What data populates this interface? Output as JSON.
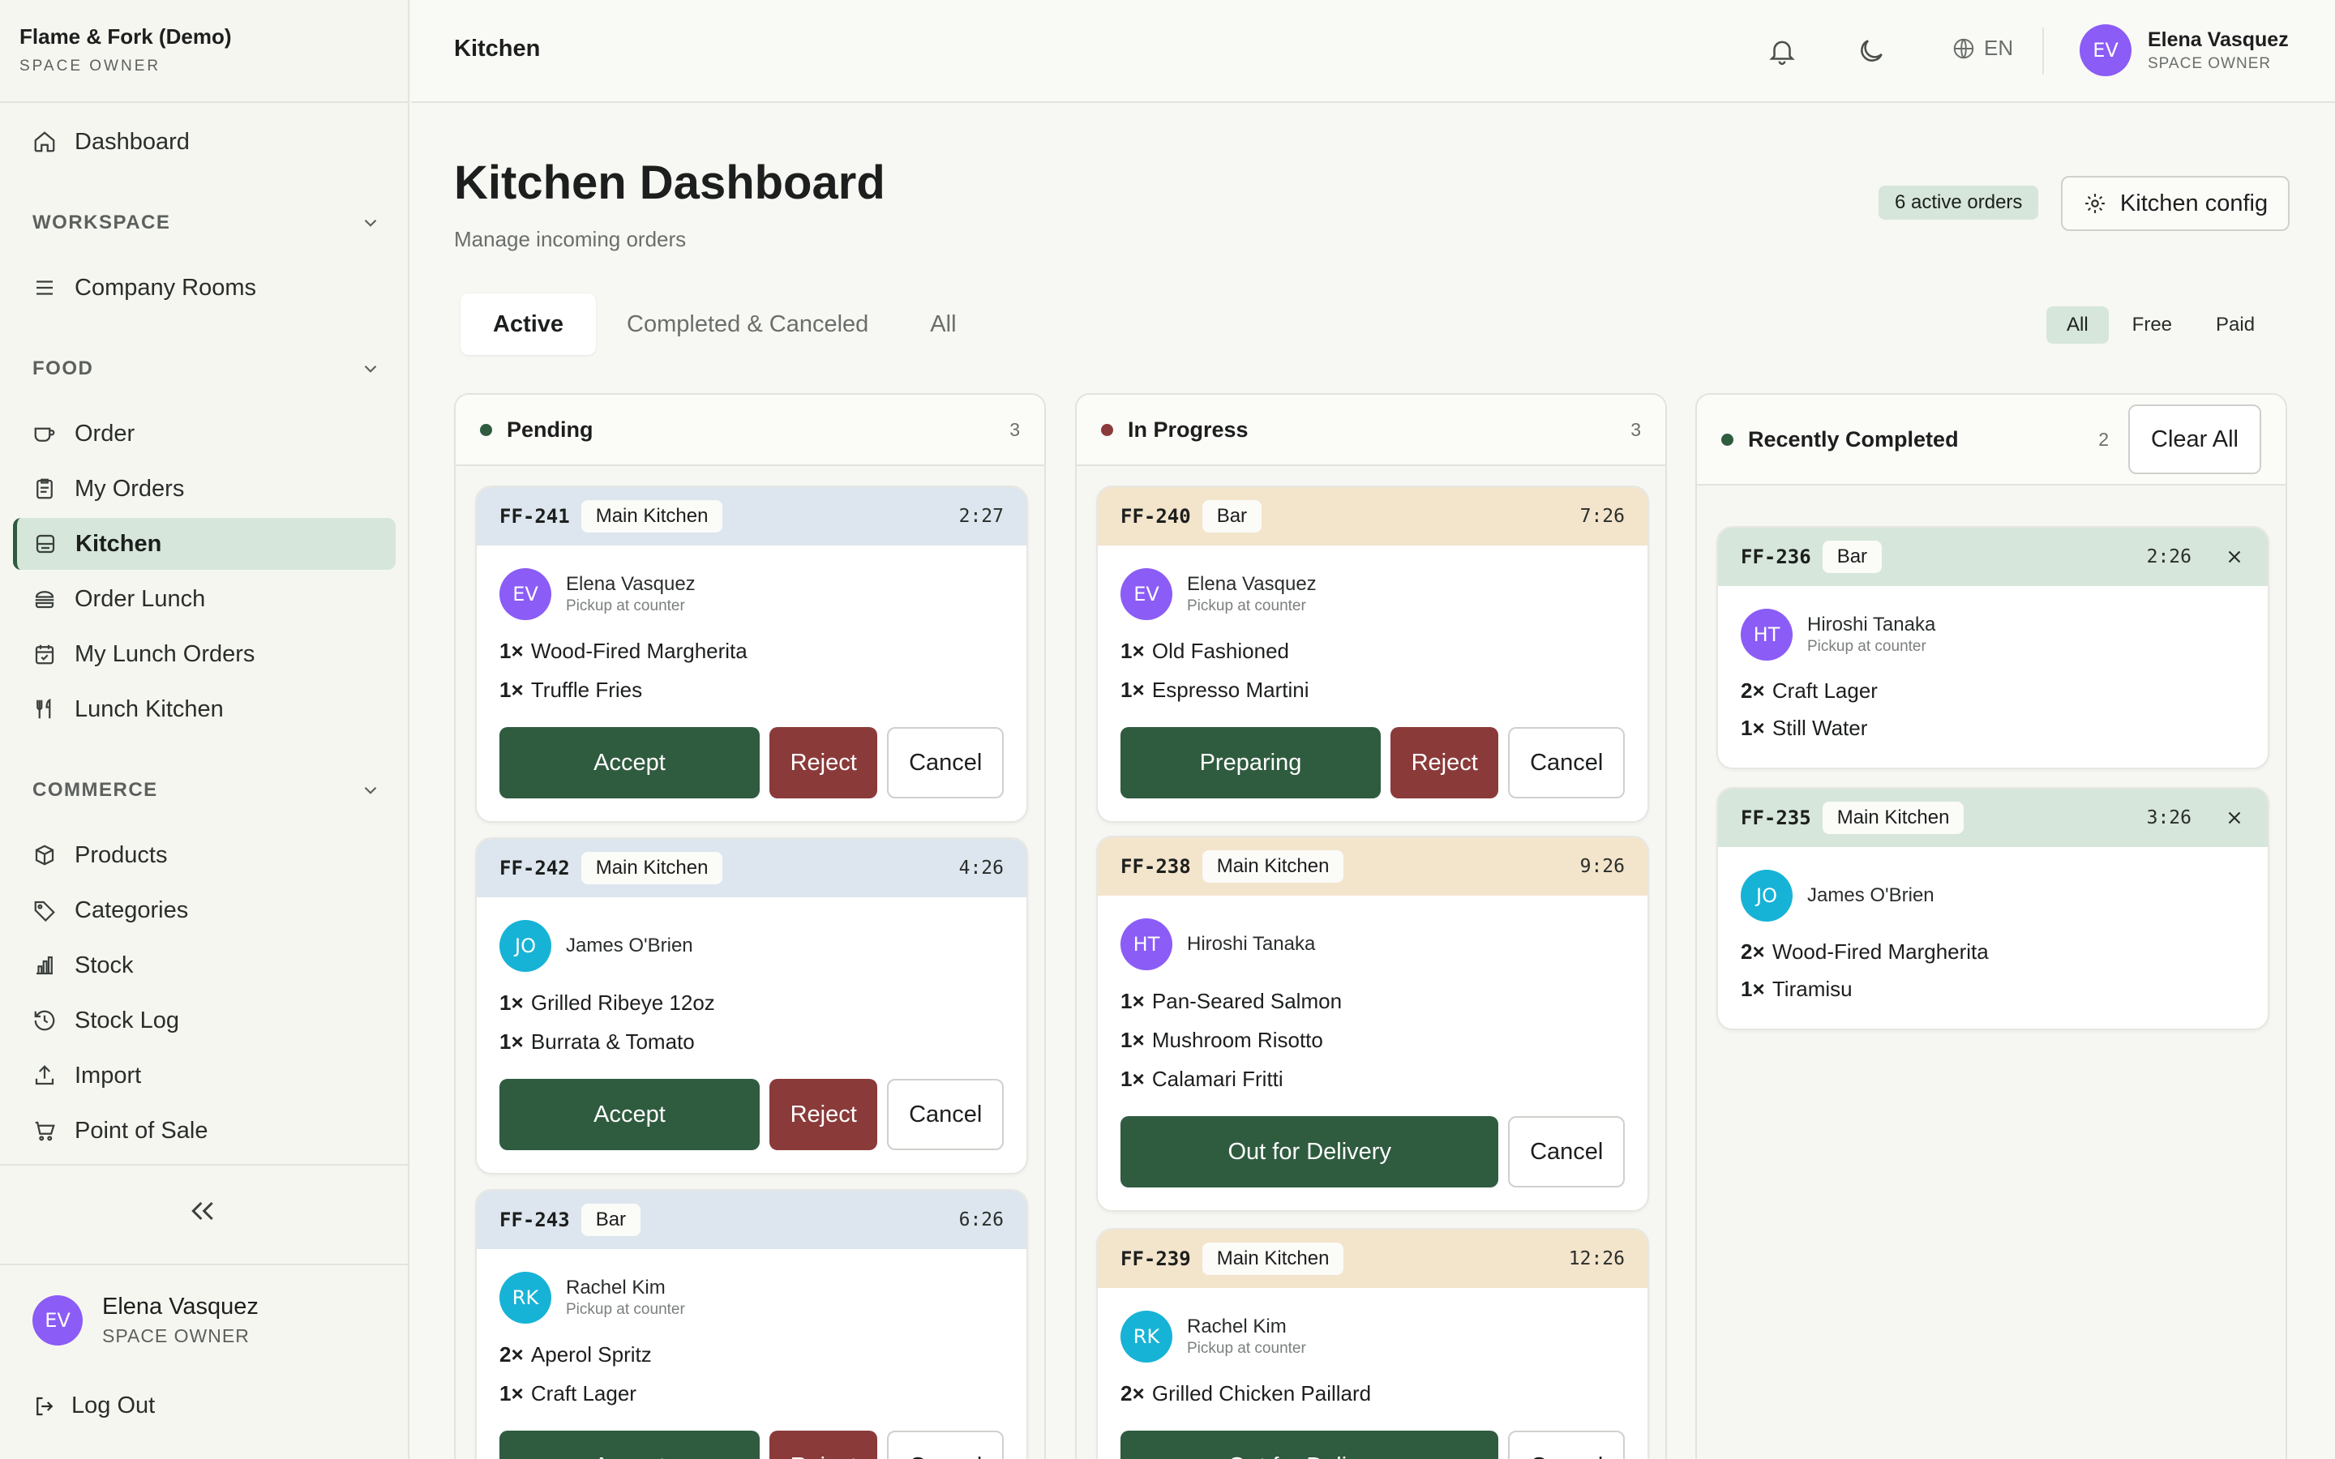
{
  "sidebar": {
    "brand_name": "Flame & Fork (Demo)",
    "brand_role": "SPACE OWNER",
    "dashboard": "Dashboard",
    "sections": {
      "workspace": "WORKSPACE",
      "food": "FOOD",
      "commerce": "COMMERCE"
    },
    "items": {
      "company_rooms": "Company Rooms",
      "order": "Order",
      "my_orders": "My Orders",
      "kitchen": "Kitchen",
      "order_lunch": "Order Lunch",
      "my_lunch_orders": "My Lunch Orders",
      "lunch_kitchen": "Lunch Kitchen",
      "products": "Products",
      "categories": "Categories",
      "stock": "Stock",
      "stock_log": "Stock Log",
      "import": "Import",
      "point_of_sale": "Point of Sale"
    },
    "user": {
      "initials": "EV",
      "name": "Elena Vasquez",
      "role": "SPACE OWNER"
    },
    "logout": "Log Out"
  },
  "topbar": {
    "title": "Kitchen",
    "lang": "EN",
    "user": {
      "initials": "EV",
      "name": "Elena Vasquez",
      "role": "SPACE OWNER"
    }
  },
  "page": {
    "title": "Kitchen Dashboard",
    "subtitle": "Manage incoming orders",
    "active_badge": "6 active orders",
    "config_button": "Kitchen config"
  },
  "tabs": [
    "Active",
    "Completed & Canceled",
    "All"
  ],
  "filters": [
    "All",
    "Free",
    "Paid"
  ],
  "columns": {
    "pending": {
      "title": "Pending",
      "count": "3",
      "dot_color": "#2f5b3f",
      "cards": [
        {
          "id": "FF-241",
          "station": "Main Kitchen",
          "time": "2:27",
          "initials": "EV",
          "customer": "Elena Vasquez",
          "note": "Pickup at counter",
          "items": [
            {
              "qty": "1×",
              "name": "Wood-Fired Margherita"
            },
            {
              "qty": "1×",
              "name": "Truffle Fries"
            }
          ],
          "primary": "Accept",
          "reject": "Reject",
          "cancel": "Cancel"
        },
        {
          "id": "FF-242",
          "station": "Main Kitchen",
          "time": "4:26",
          "initials": "JO",
          "customer": "James O'Brien",
          "note": "",
          "items": [
            {
              "qty": "1×",
              "name": "Grilled Ribeye 12oz"
            },
            {
              "qty": "1×",
              "name": "Burrata & Tomato"
            }
          ],
          "primary": "Accept",
          "reject": "Reject",
          "cancel": "Cancel"
        },
        {
          "id": "FF-243",
          "station": "Bar",
          "time": "6:26",
          "initials": "RK",
          "customer": "Rachel Kim",
          "note": "Pickup at counter",
          "items": [
            {
              "qty": "2×",
              "name": "Aperol Spritz"
            },
            {
              "qty": "1×",
              "name": "Craft Lager"
            }
          ],
          "primary": "Accept",
          "reject": "Reject",
          "cancel": "Cancel"
        }
      ]
    },
    "in_progress": {
      "title": "In Progress",
      "count": "3",
      "dot_color": "#8b3a3a",
      "cards": [
        {
          "id": "FF-240",
          "station": "Bar",
          "time": "7:26",
          "initials": "EV",
          "customer": "Elena Vasquez",
          "note": "Pickup at counter",
          "items": [
            {
              "qty": "1×",
              "name": "Old Fashioned"
            },
            {
              "qty": "1×",
              "name": "Espresso Martini"
            }
          ],
          "primary": "Preparing",
          "reject": "Reject",
          "cancel": "Cancel"
        },
        {
          "id": "FF-238",
          "station": "Main Kitchen",
          "time": "9:26",
          "initials": "HT",
          "customer": "Hiroshi Tanaka",
          "note": "",
          "items": [
            {
              "qty": "1×",
              "name": "Pan-Seared Salmon"
            },
            {
              "qty": "1×",
              "name": "Mushroom Risotto"
            },
            {
              "qty": "1×",
              "name": "Calamari Fritti"
            }
          ],
          "primary": "Out for Delivery",
          "cancel": "Cancel"
        },
        {
          "id": "FF-239",
          "station": "Main Kitchen",
          "time": "12:26",
          "initials": "RK",
          "customer": "Rachel Kim",
          "note": "Pickup at counter",
          "items": [
            {
              "qty": "2×",
              "name": "Grilled Chicken Paillard"
            }
          ],
          "primary": "Out for Delivery",
          "cancel": "Cancel"
        }
      ]
    },
    "recently_completed": {
      "title": "Recently Completed",
      "count": "2",
      "dot_color": "#2f5b3f",
      "clear_all": "Clear All",
      "cards": [
        {
          "id": "FF-236",
          "station": "Bar",
          "time": "2:26",
          "initials": "HT",
          "customer": "Hiroshi Tanaka",
          "note": "Pickup at counter",
          "items": [
            {
              "qty": "2×",
              "name": "Craft Lager"
            },
            {
              "qty": "1×",
              "name": "Still Water"
            }
          ]
        },
        {
          "id": "FF-235",
          "station": "Main Kitchen",
          "time": "3:26",
          "initials": "JO",
          "customer": "James O'Brien",
          "note": "",
          "items": [
            {
              "qty": "2×",
              "name": "Wood-Fired Margherita"
            },
            {
              "qty": "1×",
              "name": "Tiramisu"
            }
          ]
        }
      ]
    }
  }
}
